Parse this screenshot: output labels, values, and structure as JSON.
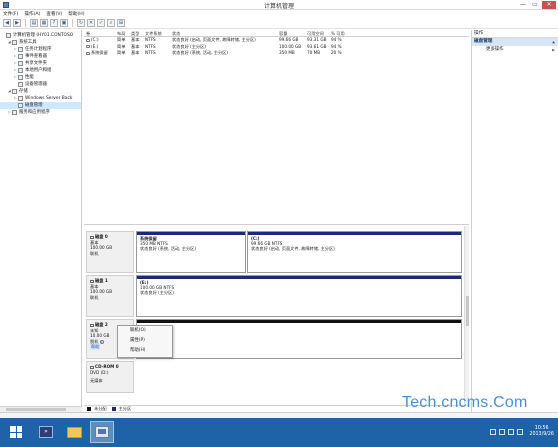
{
  "window": {
    "title": "计算机管理",
    "minimize": "—",
    "maximize": "▭",
    "close": "✕"
  },
  "menu": [
    "文件(F)",
    "操作(A)",
    "查看(V)",
    "帮助(H)"
  ],
  "toolbar_icons": [
    "back-icon",
    "forward-icon",
    "console-tree-icon",
    "properties-icon",
    "help-icon",
    "show-hide-icon",
    "refresh-icon",
    "delete-icon",
    "checkmark-icon",
    "search-icon",
    "zoom-icon"
  ],
  "tree": [
    {
      "label": "计算机管理 (HY01.CONTOSO",
      "exp": "",
      "indent": 0
    },
    {
      "label": "系统工具",
      "exp": "◢",
      "indent": 1
    },
    {
      "label": "任务计划程序",
      "exp": "▷",
      "indent": 2
    },
    {
      "label": "事件查看器",
      "exp": "▷",
      "indent": 2
    },
    {
      "label": "共享文件夹",
      "exp": "▷",
      "indent": 2
    },
    {
      "label": "本地用户和组",
      "exp": "▷",
      "indent": 2
    },
    {
      "label": "性能",
      "exp": "▷",
      "indent": 2
    },
    {
      "label": "设备管理器",
      "exp": "",
      "indent": 2
    },
    {
      "label": "存储",
      "exp": "◢",
      "indent": 1
    },
    {
      "label": "Windows Server Back",
      "exp": "▷",
      "indent": 2
    },
    {
      "label": "磁盘管理",
      "exp": "",
      "indent": 2,
      "selected": true
    },
    {
      "label": "服务和应用程序",
      "exp": "▷",
      "indent": 1
    }
  ],
  "volume_table": {
    "headers": [
      "卷",
      "布局",
      "类型",
      "文件系统",
      "状态",
      "容量",
      "可用空间",
      "% 可用"
    ],
    "rows": [
      [
        "(C:)",
        "简单",
        "基本",
        "NTFS",
        "状态良好 (启动, 页面文件, 故障转储, 主分区)",
        "99.66 GB",
        "93.31 GB",
        "94 %"
      ],
      [
        "(E:)",
        "简单",
        "基本",
        "NTFS",
        "状态良好 (主分区)",
        "100.00 GB",
        "93.61 GB",
        "94 %"
      ],
      [
        "系统保留",
        "简单",
        "基本",
        "NTFS",
        "状态良好 (系统, 活动, 主分区)",
        "350 MB",
        "70 MB",
        "20 %"
      ]
    ]
  },
  "disks": [
    {
      "name": "磁盘 0",
      "type": "基本",
      "size": "100.00 GB",
      "status": "联机",
      "partitions": [
        {
          "name": "系统保留",
          "size": "350 MB NTFS",
          "status": "状态良好 (系统, 活动, 主分区)"
        },
        {
          "name": "(C:)",
          "size": "99.66 GB NTFS",
          "status": "状态良好 (启动, 页面文件, 故障转储, 主分区)"
        }
      ]
    },
    {
      "name": "磁盘 1",
      "type": "基本",
      "size": "100.00 GB",
      "status": "联机",
      "partitions": [
        {
          "name": "(E:)",
          "size": "100.00 GB NTFS",
          "status": "状态良好 (主分区)"
        }
      ]
    },
    {
      "name": "磁盘 2",
      "type": "未知",
      "size": "10.00 GB",
      "status": "脱机",
      "help": "帮助"
    },
    {
      "name": "CD-ROM 0",
      "type": "DVD (D:)",
      "status": "无媒体"
    }
  ],
  "context_menu": [
    "联机(O)",
    "属性(P)",
    "帮助(H)"
  ],
  "legend": [
    {
      "label": "未分配",
      "color": "#111111"
    },
    {
      "label": "主分区",
      "color": "#1b2a78"
    }
  ],
  "actions": {
    "header": "操作",
    "section": "磁盘管理",
    "more": "更多操作"
  },
  "taskbar": {
    "time": "10:56",
    "date": "2013/9/26"
  },
  "watermark": "Tech.cncms.Com",
  "colors": {
    "primary_partition": "#1b2a78",
    "unallocated": "#111111",
    "taskbar": "#1e63a8",
    "selection": "#cde8ff"
  }
}
